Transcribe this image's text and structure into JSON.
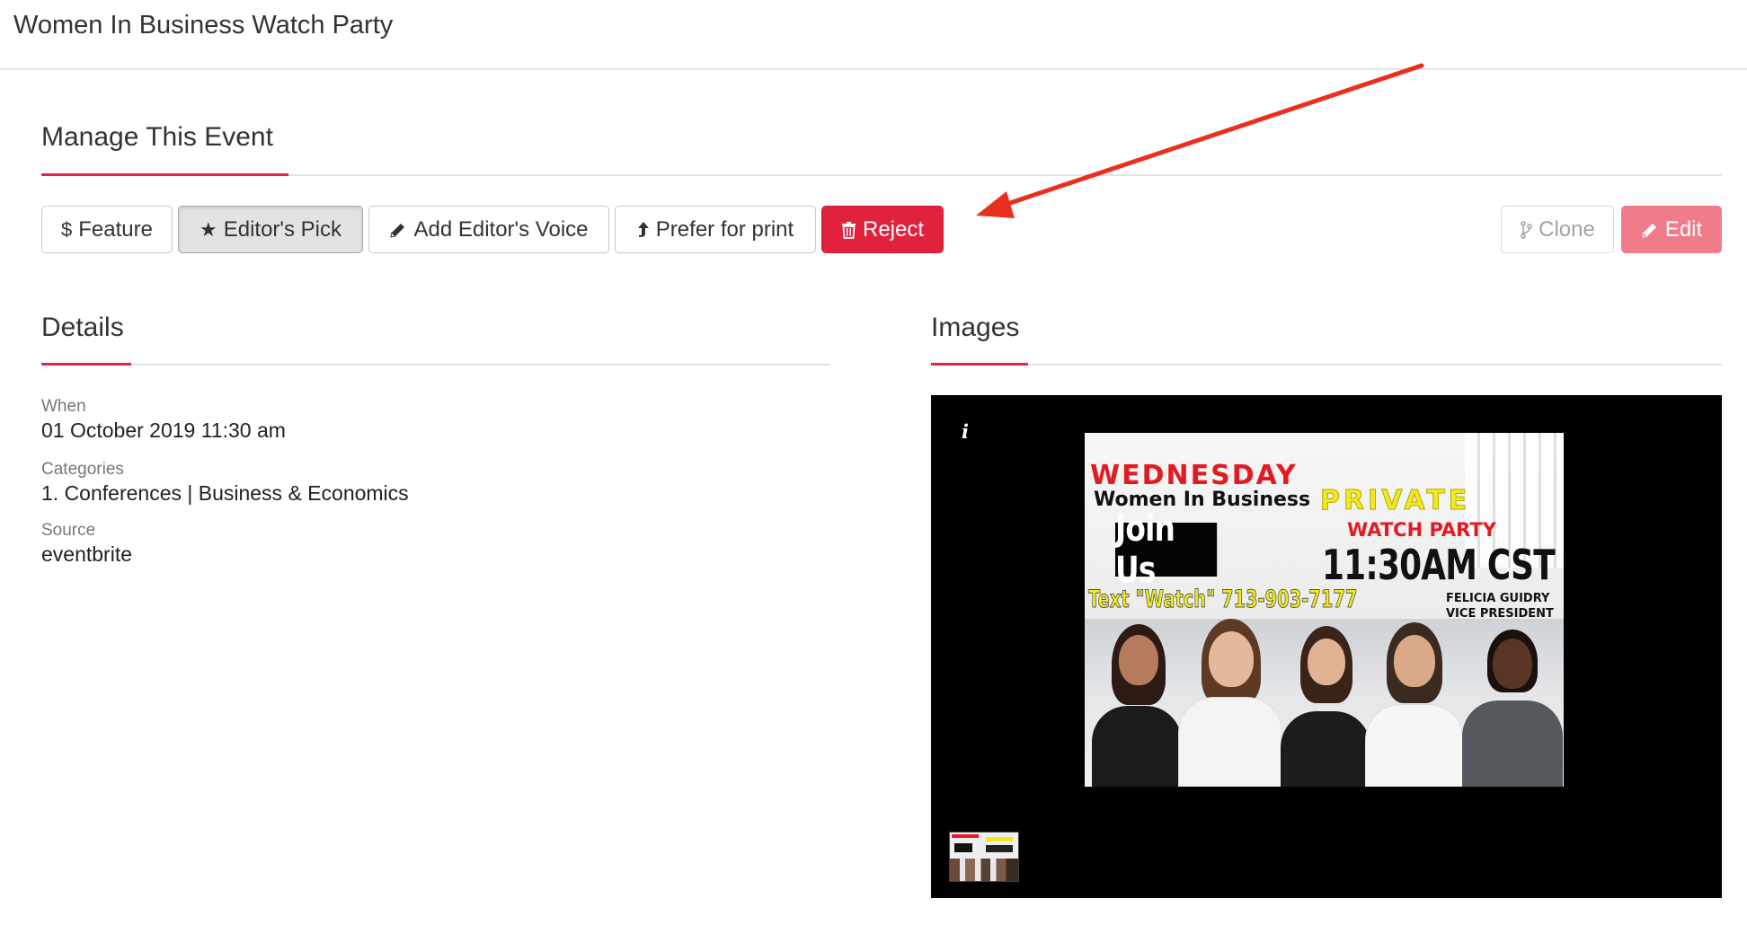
{
  "page": {
    "title": "Women In Business Watch Party"
  },
  "manage": {
    "title": "Manage This Event",
    "buttons": {
      "feature": "Feature",
      "editors_pick": "Editor's Pick",
      "add_editors_voice": "Add Editor's Voice",
      "prefer_for_print": "Prefer for print",
      "reject": "Reject",
      "clone": "Clone",
      "edit": "Edit"
    }
  },
  "details": {
    "title": "Details",
    "when_label": "When",
    "when_value": "01 October 2019 11:30 am",
    "categories_label": "Categories",
    "categories_value": "1. Conferences | Business & Economics",
    "source_label": "Source",
    "source_value": "eventbrite"
  },
  "images": {
    "title": "Images",
    "info_icon": "i",
    "flyer": {
      "day": "WEDNESDAY",
      "subtitle": "Women In Business",
      "join": "Join Us",
      "private": "PRIVATE",
      "watch_party": "WATCH PARTY",
      "time": "11:30AM CST",
      "text_line": "Text \"Watch\" 713-903-7177",
      "name": "FELICIA GUIDRY",
      "role": "VICE PRESIDENT"
    }
  },
  "colors": {
    "accent": "#e3253f",
    "reject": "#e0223d",
    "edit": "#f07c8a",
    "annotation_arrow": "#e8301e"
  },
  "icons": {
    "feature": "dollar-icon",
    "editors_pick": "star-icon",
    "add_editors_voice": "pencil-icon",
    "prefer_for_print": "upload-arrow-icon",
    "reject": "trash-icon",
    "clone": "branch-icon",
    "edit": "pencil-icon"
  }
}
